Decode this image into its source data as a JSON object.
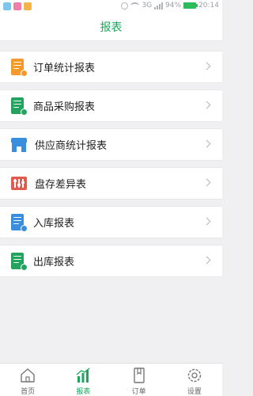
{
  "status_bar": {
    "battery": "94%",
    "time": "20:14",
    "network": "3G"
  },
  "header": {
    "title": "报表"
  },
  "colors": {
    "accent": "#1aa65b",
    "orange": "#f39a2b",
    "green": "#22a35e",
    "blue": "#3a8ede",
    "red": "#e05a4f"
  },
  "reports": [
    {
      "label": "订单统计报表",
      "icon": "order-stats-icon"
    },
    {
      "label": "商品采购报表",
      "icon": "purchase-icon"
    },
    {
      "label": "供应商统计报表",
      "icon": "supplier-store-icon"
    },
    {
      "label": "盘存差异表",
      "icon": "abacus-icon"
    },
    {
      "label": "入库报表",
      "icon": "stock-in-icon"
    },
    {
      "label": "出库报表",
      "icon": "stock-out-icon"
    }
  ],
  "nav": {
    "home": "首页",
    "reports": "报表",
    "orders": "订单",
    "settings": "设置",
    "active": "reports"
  }
}
